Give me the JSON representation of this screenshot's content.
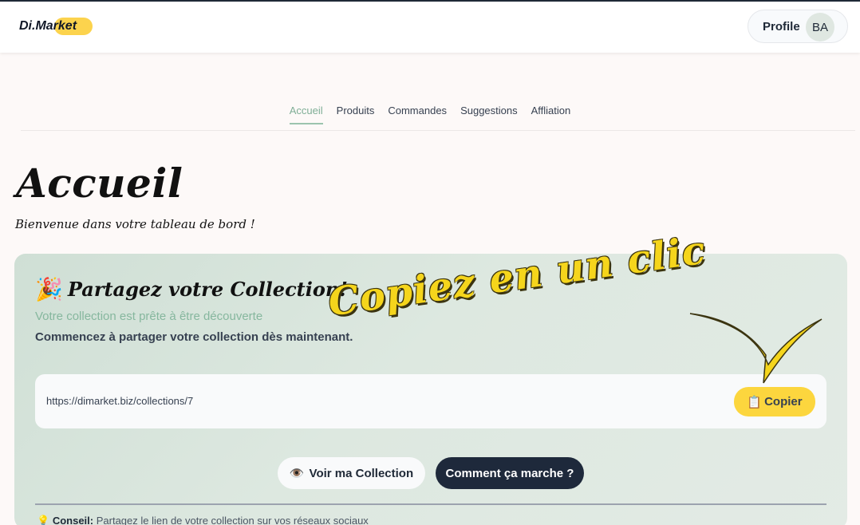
{
  "header": {
    "logo_text": "Di.Market",
    "profile_label": "Profile",
    "avatar_initials": "BA"
  },
  "nav": {
    "items": [
      {
        "label": "Accueil",
        "active": true
      },
      {
        "label": "Produits",
        "active": false
      },
      {
        "label": "Commandes",
        "active": false
      },
      {
        "label": "Suggestions",
        "active": false
      },
      {
        "label": "Affliation",
        "active": false
      }
    ]
  },
  "page": {
    "title": "Accueil",
    "subtitle": "Bienvenue dans votre tableau de bord !"
  },
  "share_card": {
    "title_emoji": "🎉",
    "title": "Partagez votre Collection!",
    "kicker": "Votre collection est prête à être découverte",
    "description": "Commencez à partager votre collection dès maintenant.",
    "url": "https://dimarket.biz/collections/7",
    "copy_emoji": "📋",
    "copy_label": "Copier",
    "view_emoji": "👁️",
    "view_label": "Voir ma Collection",
    "how_label": "Comment ça marche ?",
    "tip_emoji": "💡",
    "tip_label": "Conseil:",
    "tip_text": "Partagez le lien de votre collection sur vos réseaux sociaux"
  },
  "annotation": {
    "text": "Copiez en un clic"
  },
  "colors": {
    "accent_green": "#86b79e",
    "accent_yellow": "#fcd63e",
    "dark_button": "#1e293b"
  }
}
